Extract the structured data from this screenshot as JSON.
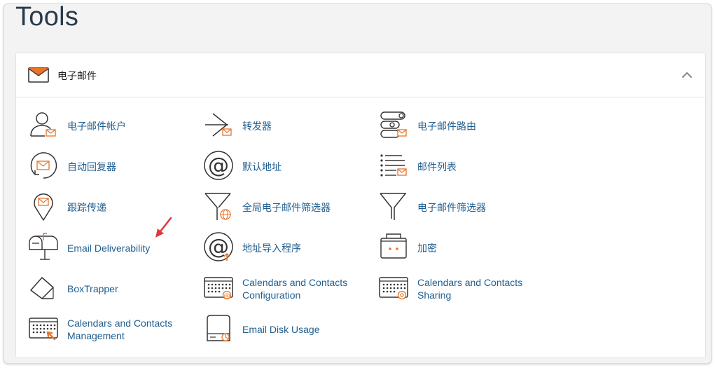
{
  "page": {
    "title": "Tools"
  },
  "section": {
    "title": "电子邮件",
    "icon": "envelope-icon",
    "collapse_icon": "chevron-up-icon"
  },
  "colors": {
    "accent": "#e8742a",
    "link": "#1f5e8f",
    "icon_stroke": "#333333",
    "arrow": "#e0393c"
  },
  "tools": [
    {
      "label": "电子邮件帐户",
      "icon": "email-accounts-icon"
    },
    {
      "label": "转发器",
      "icon": "forwarders-icon"
    },
    {
      "label": "电子邮件路由",
      "icon": "email-routing-icon"
    },
    {
      "label": "自动回复器",
      "icon": "autoresponders-icon"
    },
    {
      "label": "默认地址",
      "icon": "default-address-icon"
    },
    {
      "label": "邮件列表",
      "icon": "mailing-lists-icon"
    },
    {
      "label": "跟踪传递",
      "icon": "track-delivery-icon"
    },
    {
      "label": "全局电子邮件筛选器",
      "icon": "global-email-filters-icon"
    },
    {
      "label": "电子邮件筛选器",
      "icon": "email-filters-icon"
    },
    {
      "label": "Email Deliverability",
      "icon": "email-deliverability-icon"
    },
    {
      "label": "地址导入程序",
      "icon": "address-importer-icon"
    },
    {
      "label": "加密",
      "icon": "encryption-icon"
    },
    {
      "label": "BoxTrapper",
      "icon": "boxtrapper-icon"
    },
    {
      "label": "Calendars and Contacts Configuration",
      "icon": "calendars-contacts-configuration-icon"
    },
    {
      "label": "Calendars and Contacts Sharing",
      "icon": "calendars-contacts-sharing-icon"
    },
    {
      "label": "Calendars and Contacts Management",
      "icon": "calendars-contacts-management-icon"
    },
    {
      "label": "Email Disk Usage",
      "icon": "email-disk-usage-icon"
    }
  ],
  "annotation": {
    "icon": "red-arrow-icon"
  }
}
